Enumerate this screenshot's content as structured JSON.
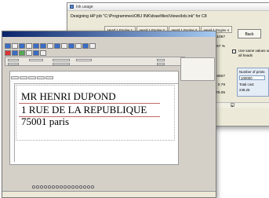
{
  "ink_window": {
    "title": "Ink usage",
    "description": "Designing HP job \"C:\\Programmes\\OBJ INK\\draw\\files\\Views\\lob.ink\" for C8",
    "heads": [
      "Head 1 Engine 1",
      "Head 1 Engine 2",
      "Head 1 Engine 3",
      "Head 1 Engine 4"
    ],
    "values": [
      "11057",
      "0.67 %",
      "128507",
      "0.79",
      "79.05"
    ],
    "back_label": "Back",
    "same_values_label": "Use same values on all heads",
    "prints_label": "Number of prints",
    "prints_value": "100000",
    "total_cost_label": "Total cost",
    "total_cost_value": "249.25"
  },
  "main_window": {
    "address_lines": [
      "MR HENRI DUPOND",
      "1 RUE DE LA REPUBLIQUE",
      "75001 paris"
    ]
  },
  "colors": {
    "title_gradient_start": "#0a246a",
    "title_gradient_end": "#a6caf0",
    "address_underline": "#c06a6a",
    "prints_box_bg": "#e4ecf6"
  }
}
